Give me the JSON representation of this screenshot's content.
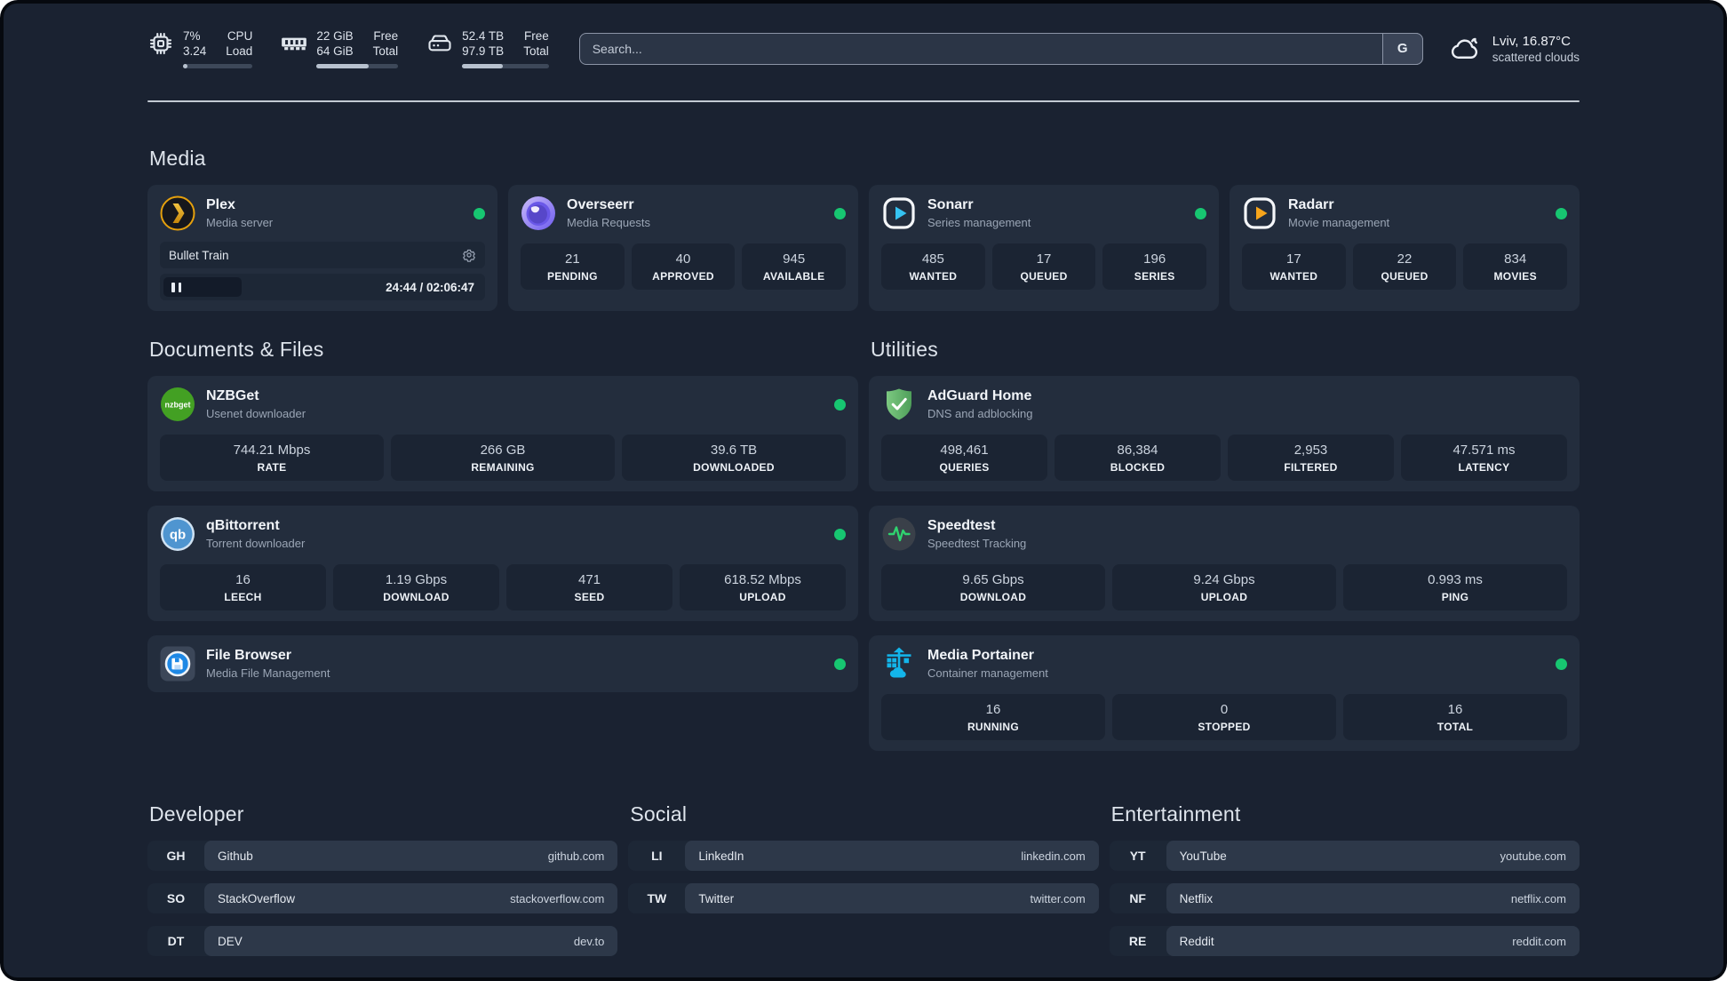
{
  "topbar": {
    "metrics": [
      {
        "id": "cpu",
        "icon": "cpu-icon",
        "values": [
          "7%",
          "3.24"
        ],
        "labels": [
          "CPU",
          "Load"
        ],
        "progress_percent": 7
      },
      {
        "id": "memory",
        "icon": "ram-icon",
        "values": [
          "22 GiB",
          "64 GiB"
        ],
        "labels": [
          "Free",
          "Total"
        ],
        "progress_percent": 64
      },
      {
        "id": "disk",
        "icon": "disk-icon",
        "values": [
          "52.4 TB",
          "97.9 TB"
        ],
        "labels": [
          "Free",
          "Total"
        ],
        "progress_percent": 47
      }
    ],
    "search": {
      "placeholder": "Search...",
      "button_label": "G"
    },
    "weather": {
      "title": "Lviv, 16.87°C",
      "subtitle": "scattered clouds"
    }
  },
  "media": {
    "title": "Media",
    "cards": [
      {
        "id": "plex",
        "icon": "plex-icon",
        "title": "Plex",
        "subtitle": "Media server",
        "online": true,
        "player": {
          "title": "Bullet Train",
          "state": "paused",
          "time": "24:44 / 02:06:47"
        }
      },
      {
        "id": "overseerr",
        "icon": "overseerr-icon",
        "title": "Overseerr",
        "subtitle": "Media Requests",
        "online": true,
        "stats": [
          {
            "value": "21",
            "label": "PENDING"
          },
          {
            "value": "40",
            "label": "APPROVED"
          },
          {
            "value": "945",
            "label": "AVAILABLE"
          }
        ]
      },
      {
        "id": "sonarr",
        "icon": "sonarr-icon",
        "title": "Sonarr",
        "subtitle": "Series management",
        "online": true,
        "stats": [
          {
            "value": "485",
            "label": "WANTED"
          },
          {
            "value": "17",
            "label": "QUEUED"
          },
          {
            "value": "196",
            "label": "SERIES"
          }
        ]
      },
      {
        "id": "radarr",
        "icon": "radarr-icon",
        "title": "Radarr",
        "subtitle": "Movie management",
        "online": true,
        "stats": [
          {
            "value": "17",
            "label": "WANTED"
          },
          {
            "value": "22",
            "label": "QUEUED"
          },
          {
            "value": "834",
            "label": "MOVIES"
          }
        ]
      }
    ]
  },
  "columns": [
    {
      "title": "Documents & Files",
      "cards": [
        {
          "id": "nzbget",
          "icon": "nzbget-icon",
          "title": "NZBGet",
          "subtitle": "Usenet downloader",
          "online": true,
          "stats": [
            {
              "value": "744.21 Mbps",
              "label": "RATE"
            },
            {
              "value": "266 GB",
              "label": "REMAINING"
            },
            {
              "value": "39.6 TB",
              "label": "DOWNLOADED"
            }
          ]
        },
        {
          "id": "qbittorrent",
          "icon": "qbittorrent-icon",
          "title": "qBittorrent",
          "subtitle": "Torrent downloader",
          "online": true,
          "stats": [
            {
              "value": "16",
              "label": "LEECH"
            },
            {
              "value": "1.19 Gbps",
              "label": "DOWNLOAD"
            },
            {
              "value": "471",
              "label": "SEED"
            },
            {
              "value": "618.52 Mbps",
              "label": "UPLOAD"
            }
          ]
        },
        {
          "id": "filebrowser",
          "icon": "filebrowser-icon",
          "title": "File Browser",
          "subtitle": "Media File Management",
          "online": true
        }
      ]
    },
    {
      "title": "Utilities",
      "cards": [
        {
          "id": "adguard",
          "icon": "adguard-icon",
          "title": "AdGuard Home",
          "subtitle": "DNS and adblocking",
          "online": false,
          "stats": [
            {
              "value": "498,461",
              "label": "QUERIES"
            },
            {
              "value": "86,384",
              "label": "BLOCKED"
            },
            {
              "value": "2,953",
              "label": "FILTERED"
            },
            {
              "value": "47.571 ms",
              "label": "LATENCY"
            }
          ]
        },
        {
          "id": "speedtest",
          "icon": "speedtest-icon",
          "title": "Speedtest",
          "subtitle": "Speedtest Tracking",
          "online": false,
          "stats": [
            {
              "value": "9.65 Gbps",
              "label": "DOWNLOAD"
            },
            {
              "value": "9.24 Gbps",
              "label": "UPLOAD"
            },
            {
              "value": "0.993 ms",
              "label": "PING"
            }
          ]
        },
        {
          "id": "portainer",
          "icon": "portainer-icon",
          "title": "Media Portainer",
          "subtitle": "Container management",
          "online": true,
          "stats": [
            {
              "value": "16",
              "label": "RUNNING"
            },
            {
              "value": "0",
              "label": "STOPPED"
            },
            {
              "value": "16",
              "label": "TOTAL"
            }
          ]
        }
      ]
    }
  ],
  "bookmarks": [
    {
      "title": "Developer",
      "links": [
        {
          "abbr": "GH",
          "name": "Github",
          "url": "github.com"
        },
        {
          "abbr": "SO",
          "name": "StackOverflow",
          "url": "stackoverflow.com"
        },
        {
          "abbr": "DT",
          "name": "DEV",
          "url": "dev.to"
        }
      ]
    },
    {
      "title": "Social",
      "links": [
        {
          "abbr": "LI",
          "name": "LinkedIn",
          "url": "linkedin.com"
        },
        {
          "abbr": "TW",
          "name": "Twitter",
          "url": "twitter.com"
        }
      ]
    },
    {
      "title": "Entertainment",
      "links": [
        {
          "abbr": "YT",
          "name": "YouTube",
          "url": "youtube.com"
        },
        {
          "abbr": "NF",
          "name": "Netflix",
          "url": "netflix.com"
        },
        {
          "abbr": "RE",
          "name": "Reddit",
          "url": "reddit.com"
        }
      ]
    }
  ],
  "colors": {
    "background": "#1a2231",
    "card": "#232d3d",
    "stat_box": "#1b2433",
    "online_dot": "#17c671",
    "plex_gold": "#e5a00d",
    "sonarr_blue": "#35c3f2",
    "radarr_gold": "#f8a51b",
    "nzbget_green": "#43a023",
    "qbittorrent_blue": "#4f95d0",
    "adguard_green": "#63b26e",
    "speedtest_green": "#2fd36f",
    "portainer_blue": "#13b5ea"
  }
}
